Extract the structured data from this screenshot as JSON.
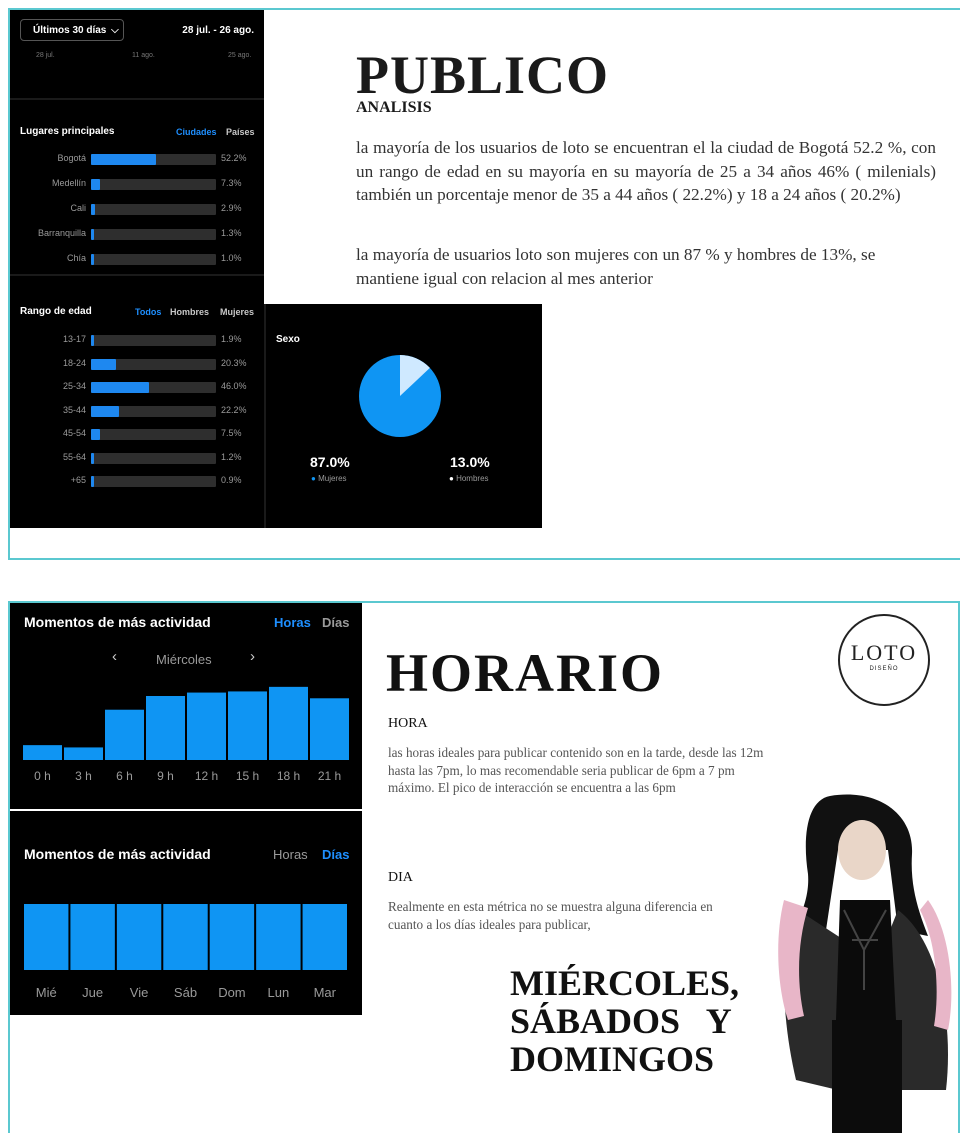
{
  "slide1": {
    "stats_panel": {
      "range_selector": "Últimos 30 días",
      "date_range": "28 jul. - 26 ago.",
      "axis_dates": [
        "28 jul.",
        "11 ago.",
        "25 ago."
      ],
      "locations": {
        "title": "Lugares principales",
        "tabs": [
          "Ciudades",
          "Países"
        ],
        "rows": [
          {
            "label": "Bogotá",
            "value": "52.2%",
            "pct": 52.2
          },
          {
            "label": "Medellín",
            "value": "7.3%",
            "pct": 7.3
          },
          {
            "label": "Cali",
            "value": "2.9%",
            "pct": 2.9
          },
          {
            "label": "Barranquilla",
            "value": "1.3%",
            "pct": 1.3
          },
          {
            "label": "Chía",
            "value": "1.0%",
            "pct": 1.0
          }
        ]
      },
      "age": {
        "title": "Rango de edad",
        "tabs": [
          "Todos",
          "Hombres",
          "Mujeres"
        ],
        "rows": [
          {
            "label": "13-17",
            "value": "1.9%",
            "pct": 1.9
          },
          {
            "label": "18-24",
            "value": "20.3%",
            "pct": 20.3
          },
          {
            "label": "25-34",
            "value": "46.0%",
            "pct": 46.0
          },
          {
            "label": "35-44",
            "value": "22.2%",
            "pct": 22.2
          },
          {
            "label": "45-54",
            "value": "7.5%",
            "pct": 7.5
          },
          {
            "label": "55-64",
            "value": "1.2%",
            "pct": 1.2
          },
          {
            "label": "+65",
            "value": "0.9%",
            "pct": 0.9
          }
        ]
      },
      "sex": {
        "title": "Sexo",
        "women_value": "87.0%",
        "women_label": "Mujeres",
        "men_value": "13.0%",
        "men_label": "Hombres",
        "women_pct": 87.0,
        "men_pct": 13.0,
        "women_color": "#0f95f3",
        "men_color": "#cfe9ff"
      }
    },
    "title": "PUBLICO",
    "subtitle": "ANALISIS",
    "body_1": "la mayoría de los usuarios de loto se encuentran el la ciudad de Bogotá 52.2 %, con un rango de edad en su mayoría en su mayoría de 25 a 34 años 46% ( milenials) también un porcentaje menor de 35 a 44 años ( 22.2%) y 18 a 24 años ( 20.2%)",
    "body_2": "la mayoría de usuarios loto son mujeres con un 87 % y hombres de 13%, se mantiene igual con relacion al mes anterior"
  },
  "slide2": {
    "hours_panel": {
      "title": "Momentos de más actividad",
      "tab_hours": "Horas",
      "tab_days": "Días",
      "day_selector": "Miércoles",
      "chart_data": {
        "type": "bar",
        "categories": [
          "0 h",
          "3 h",
          "6 h",
          "9 h",
          "12 h",
          "15 h",
          "18 h",
          "21 h"
        ],
        "values": [
          13,
          11,
          44,
          56,
          59,
          60,
          64,
          54
        ],
        "ylim": [
          0,
          70
        ]
      }
    },
    "days_panel": {
      "title": "Momentos de más actividad",
      "tab_hours": "Horas",
      "tab_days": "Días",
      "chart_data": {
        "type": "bar",
        "categories": [
          "Mié",
          "Jue",
          "Vie",
          "Sáb",
          "Dom",
          "Lun",
          "Mar"
        ],
        "values": [
          100,
          100,
          100,
          100,
          100,
          100,
          100
        ],
        "ylim": [
          0,
          100
        ]
      }
    },
    "title": "HORARIO",
    "hora_heading": "HORA",
    "hora_text": "las horas ideales para publicar contenido son en la tarde, desde las 12m hasta las 7pm, lo mas recomendable seria publicar de 6pm a 7 pm máximo. El pico de interacción se encuentra a las 6pm",
    "dia_heading": "DIA",
    "dia_text": "Realmente en esta métrica no se muestra alguna diferencia en cuanto a los días ideales para publicar,",
    "days_highlight": [
      "MIÉRCOLES,",
      "SÁBADOS Y",
      "DOMINGOS"
    ],
    "logo_main": "LOTO",
    "logo_sub": "DISEÑO",
    "accent": "#5bc8d0"
  }
}
